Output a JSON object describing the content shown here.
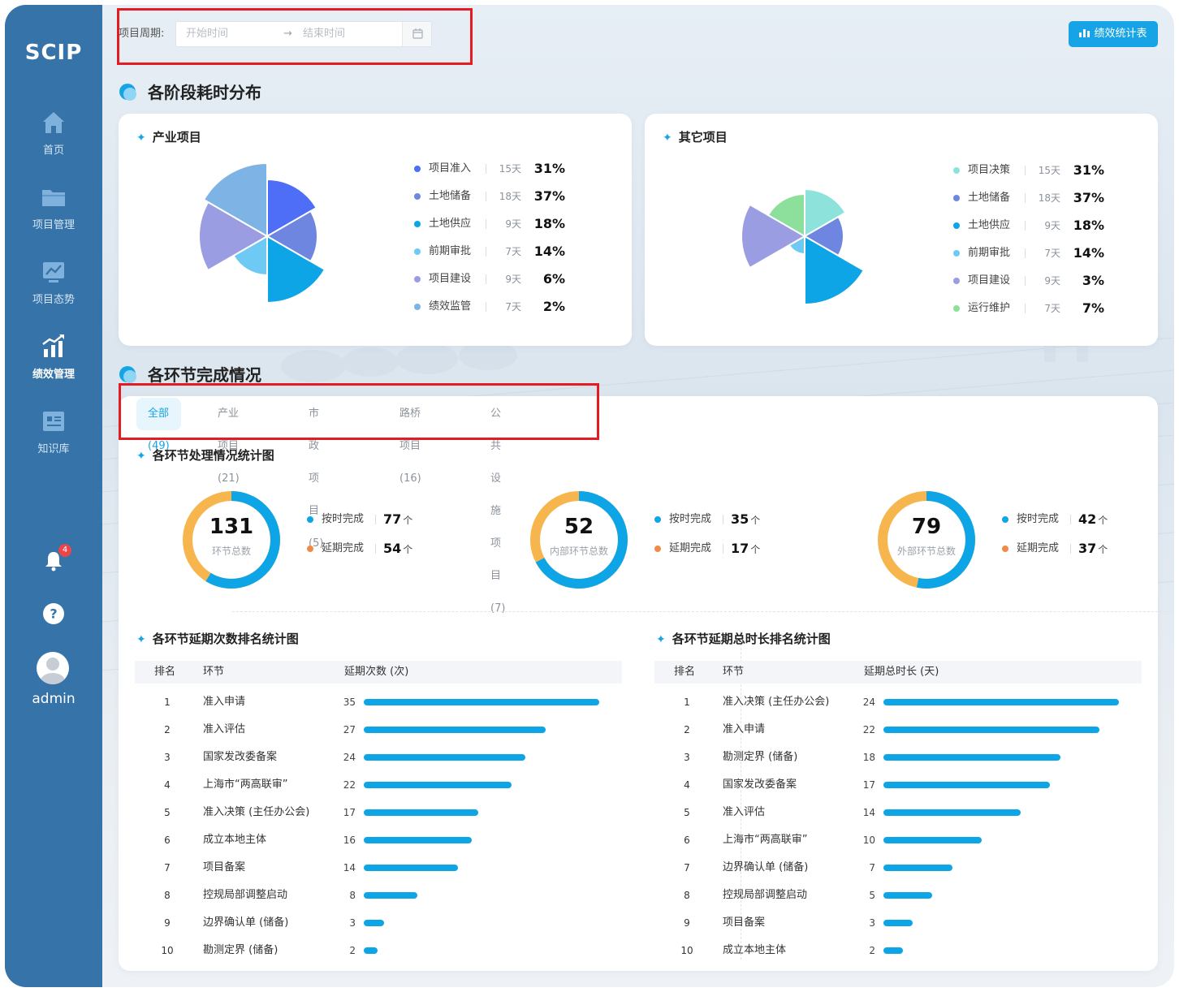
{
  "app": {
    "logo": "SCIP"
  },
  "sidebar": {
    "items": [
      {
        "label": "首页",
        "icon": "home-icon"
      },
      {
        "label": "项目管理",
        "icon": "folder-icon"
      },
      {
        "label": "项目态势",
        "icon": "trend-icon"
      },
      {
        "label": "绩效管理",
        "icon": "performance-icon",
        "active": true
      },
      {
        "label": "知识库",
        "icon": "book-icon"
      }
    ],
    "notification_count": "4",
    "help_icon": "question-icon",
    "user": "admin"
  },
  "filter": {
    "label": "项目周期:",
    "start_placeholder": "开始时间",
    "arrow": "→",
    "end_placeholder": "结束时间"
  },
  "header": {
    "stats_button": "绩效统计表"
  },
  "section1": {
    "title": "各阶段耗时分布"
  },
  "section2": {
    "title": "各环节完成情况"
  },
  "industry": {
    "title": "产业项目",
    "legend": [
      {
        "name": "项目准入",
        "days": "15天",
        "pct": "31%",
        "color": "#4f6ef7"
      },
      {
        "name": "土地储备",
        "days": "18天",
        "pct": "37%",
        "color": "#6f86e0"
      },
      {
        "name": "土地供应",
        "days": "9天",
        "pct": "18%",
        "color": "#0ea5e6"
      },
      {
        "name": "前期审批",
        "days": "7天",
        "pct": "14%",
        "color": "#6ec9f5"
      },
      {
        "name": "项目建设",
        "days": "9天",
        "pct": "6%",
        "color": "#9b9de3"
      },
      {
        "name": "绩效监管",
        "days": "7天",
        "pct": "2%",
        "color": "#7eb3e6"
      }
    ]
  },
  "other": {
    "title": "其它项目",
    "legend": [
      {
        "name": "项目决策",
        "days": "15天",
        "pct": "31%",
        "color": "#8de3dc"
      },
      {
        "name": "土地储备",
        "days": "18天",
        "pct": "37%",
        "color": "#6f86e0"
      },
      {
        "name": "土地供应",
        "days": "9天",
        "pct": "18%",
        "color": "#0ea5e6"
      },
      {
        "name": "前期审批",
        "days": "7天",
        "pct": "14%",
        "color": "#6ec9f5"
      },
      {
        "name": "项目建设",
        "days": "9天",
        "pct": "3%",
        "color": "#9b9de3"
      },
      {
        "name": "运行维护",
        "days": "7天",
        "pct": "7%",
        "color": "#8ddf9c"
      }
    ]
  },
  "tabs": [
    {
      "label": "全部(49)",
      "active": true
    },
    {
      "label": "产业项目(21)"
    },
    {
      "label": "市政项目(5)"
    },
    {
      "label": "路桥项目(16)"
    },
    {
      "label": "公共设施项目(7)"
    }
  ],
  "stats": {
    "title": "各环节处理情况统计图",
    "donuts": [
      {
        "total": "131",
        "label": "环节总数",
        "on_time_label": "按时完成",
        "on_time": "77",
        "late_label": "延期完成",
        "late": "54",
        "unit": "个"
      },
      {
        "total": "52",
        "label": "内部环节总数",
        "on_time_label": "按时完成",
        "on_time": "35",
        "late_label": "延期完成",
        "late": "17",
        "unit": "个"
      },
      {
        "total": "79",
        "label": "外部环节总数",
        "on_time_label": "按时完成",
        "on_time": "42",
        "late_label": "延期完成",
        "late": "37",
        "unit": "个"
      }
    ],
    "colors": {
      "on_time": "#0ea5e6",
      "late": "#f7b54d"
    }
  },
  "delay_count": {
    "title": "各环节延期次数排名统计图",
    "headers": [
      "排名",
      "环节",
      "延期次数 (次)"
    ],
    "rows": [
      {
        "rank": "1",
        "name": "准入申请",
        "value": 35
      },
      {
        "rank": "2",
        "name": "准入评估",
        "value": 27
      },
      {
        "rank": "3",
        "name": "国家发改委备案",
        "value": 24
      },
      {
        "rank": "4",
        "name": "上海市“两高联审”",
        "value": 22
      },
      {
        "rank": "5",
        "name": "准入决策 (主任办公会)",
        "value": 17
      },
      {
        "rank": "6",
        "name": "成立本地主体",
        "value": 16
      },
      {
        "rank": "7",
        "name": "项目备案",
        "value": 14
      },
      {
        "rank": "8",
        "name": "控规局部调整启动",
        "value": 8
      },
      {
        "rank": "9",
        "name": "边界确认单 (储备)",
        "value": 3
      },
      {
        "rank": "10",
        "name": "勘测定界 (储备)",
        "value": 2
      }
    ]
  },
  "delay_duration": {
    "title": "各环节延期总时长排名统计图",
    "headers": [
      "排名",
      "环节",
      "延期总时长 (天)"
    ],
    "rows": [
      {
        "rank": "1",
        "name": "准入决策 (主任办公会)",
        "value": 24
      },
      {
        "rank": "2",
        "name": "准入申请",
        "value": 22
      },
      {
        "rank": "3",
        "name": "勘测定界 (储备)",
        "value": 18
      },
      {
        "rank": "4",
        "name": "国家发改委备案",
        "value": 17
      },
      {
        "rank": "5",
        "name": "准入评估",
        "value": 14
      },
      {
        "rank": "6",
        "name": "上海市“两高联审”",
        "value": 10
      },
      {
        "rank": "7",
        "name": "边界确认单 (储备)",
        "value": 7
      },
      {
        "rank": "8",
        "name": "控规局部调整启动",
        "value": 5
      },
      {
        "rank": "9",
        "name": "项目备案",
        "value": 3
      },
      {
        "rank": "10",
        "name": "成立本地主体",
        "value": 2
      }
    ]
  }
}
